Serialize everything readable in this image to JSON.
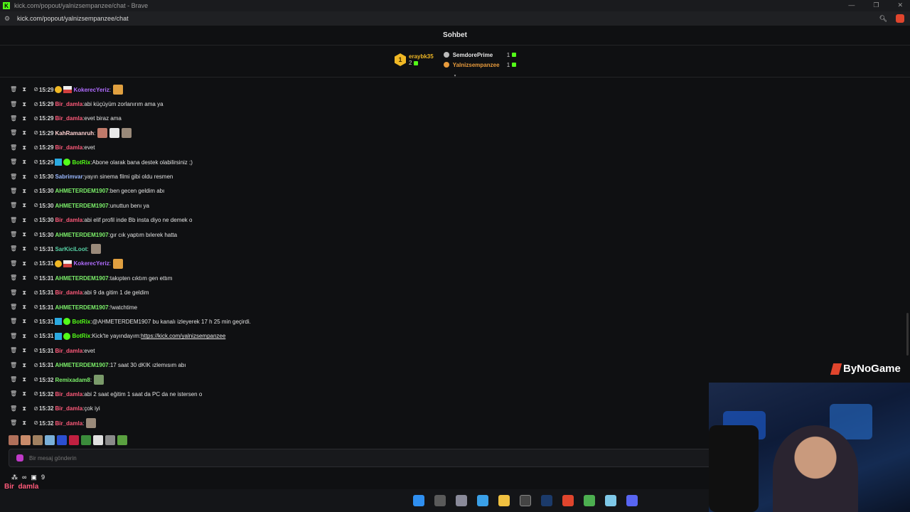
{
  "browser": {
    "window_title": "kick.com/popout/yalnizsempanzee/chat - Brave",
    "url": "kick.com/popout/yalnizsempanzee/chat"
  },
  "chat": {
    "title": "Sohbet",
    "top_gifters": [
      {
        "name": "eraybk35",
        "count": "2",
        "rank": "1"
      },
      {
        "name": "SemdorePrime",
        "count": "1"
      },
      {
        "name": "Yalnizsempanzee",
        "count": "1"
      }
    ],
    "input_placeholder": "Bir mesaj gönderin"
  },
  "colors": {
    "accent_green": "#53fc18",
    "pink_user": "#ff5a7a",
    "green_user": "#7cf06a",
    "purple_user": "#b06cff",
    "blue_user": "#9ab8ff",
    "bot_user": "#53fc18",
    "teal_user": "#58d6a8"
  },
  "messages": [
    {
      "time": "15:29",
      "user": "KokerecYeriz",
      "color": "#b06cff",
      "badges": [
        "sub",
        "hat"
      ],
      "text": "",
      "emotes": 1
    },
    {
      "time": "15:29",
      "user": "Bir_damla",
      "color": "#ff5a7a",
      "badges": [],
      "text": "abi küçüyüm zorlanırım ama ya"
    },
    {
      "time": "15:29",
      "user": "Bir_damla",
      "color": "#ff5a7a",
      "badges": [],
      "text": "evet biraz ama"
    },
    {
      "time": "15:29",
      "user": "KahRamanruh",
      "color": "#ffd0d0",
      "badges": [],
      "text": "",
      "emotes": 3
    },
    {
      "time": "15:29",
      "user": "Bir_damla",
      "color": "#ff5a7a",
      "badges": [],
      "text": "evet"
    },
    {
      "time": "15:29",
      "user": "BotRix",
      "color": "#53fc18",
      "badges": [
        "bot",
        "verified"
      ],
      "text": "Abone olarak bana destek olabilirsiniz ;)"
    },
    {
      "time": "15:30",
      "user": "Sabrimvar",
      "color": "#9ab8ff",
      "badges": [],
      "text": "yayın sinema filmi gibi oldu resmen"
    },
    {
      "time": "15:30",
      "user": "AHMETERDEM1907",
      "color": "#7cf06a",
      "badges": [],
      "text": "ben gecen geldim abı"
    },
    {
      "time": "15:30",
      "user": "AHMETERDEM1907",
      "color": "#7cf06a",
      "badges": [],
      "text": "unuttun benı ya"
    },
    {
      "time": "15:30",
      "user": "Bir_damla",
      "color": "#ff5a7a",
      "badges": [],
      "text": "abi elif profil inde Bb insta diyo ne demek o"
    },
    {
      "time": "15:30",
      "user": "AHMETERDEM1907",
      "color": "#7cf06a",
      "badges": [],
      "text": "gır cık yaptım bılerek hatta"
    },
    {
      "time": "15:31",
      "user": "SarKiciLoot",
      "color": "#58d6a8",
      "badges": [],
      "text": "",
      "emotes": 1
    },
    {
      "time": "15:31",
      "user": "KokerecYeriz",
      "color": "#b06cff",
      "badges": [
        "sub",
        "hat"
      ],
      "text": "",
      "emotes": 1
    },
    {
      "time": "15:31",
      "user": "AHMETERDEM1907",
      "color": "#7cf06a",
      "badges": [],
      "text": "takıpten cıktım gen ettım"
    },
    {
      "time": "15:31",
      "user": "Bir_damla",
      "color": "#ff5a7a",
      "badges": [],
      "text": "abi 9 da gitim 1 de geldim"
    },
    {
      "time": "15:31",
      "user": "AHMETERDEM1907",
      "color": "#7cf06a",
      "badges": [],
      "text": "!watchtime"
    },
    {
      "time": "15:31",
      "user": "BotRix",
      "color": "#53fc18",
      "badges": [
        "bot",
        "verified"
      ],
      "text": "@AHMETERDEM1907 bu kanalı izleyerek 17 h 25 min geçirdi."
    },
    {
      "time": "15:31",
      "user": "BotRix",
      "color": "#53fc18",
      "badges": [
        "bot",
        "verified"
      ],
      "text": "Kick'te yayındayım: ",
      "link": "https://kick.com/yalnizsempanzee"
    },
    {
      "time": "15:31",
      "user": "Bir_damla",
      "color": "#ff5a7a",
      "badges": [],
      "text": "evet"
    },
    {
      "time": "15:31",
      "user": "AHMETERDEM1907",
      "color": "#7cf06a",
      "badges": [],
      "text": "17 saat 30 dKIK ızlemısım abı"
    },
    {
      "time": "15:32",
      "user": "Remixadam8",
      "color": "#7cf06a",
      "badges": [],
      "text": "",
      "emotes": 1
    },
    {
      "time": "15:32",
      "user": "Bir_damla",
      "color": "#ff5a7a",
      "badges": [],
      "text": "abi 2 saat eğitim 1 saat da PC da ne istersen o"
    },
    {
      "time": "15:32",
      "user": "Bir_damla",
      "color": "#ff5a7a",
      "badges": [],
      "text": "çok iyi"
    },
    {
      "time": "15:32",
      "user": "Bir_damla",
      "color": "#ff5a7a",
      "badges": [],
      "text": "",
      "emotes": 1
    }
  ],
  "overlay": {
    "watermark": "ByNoGame",
    "bottom_user": "Bir_damla",
    "bottom_count": "9",
    "bottom_infinity": "∞"
  }
}
